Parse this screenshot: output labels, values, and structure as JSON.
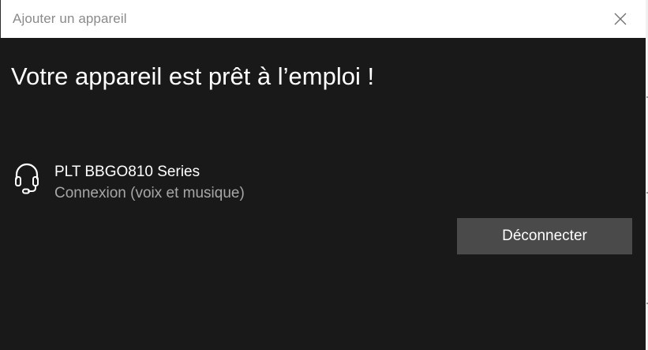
{
  "window": {
    "title": "Ajouter un appareil"
  },
  "heading": "Votre appareil est prêt à l’emploi !",
  "device": {
    "icon": "headset-icon",
    "name": "PLT BBGO810 Series",
    "status": "Connexion (voix et musique)"
  },
  "actions": {
    "disconnect_label": "Déconnecter"
  },
  "colors": {
    "background": "#191919",
    "titlebar": "#ffffff",
    "button": "#4a4a4a",
    "text_primary": "#ffffff",
    "text_secondary": "#a7a7a7"
  }
}
